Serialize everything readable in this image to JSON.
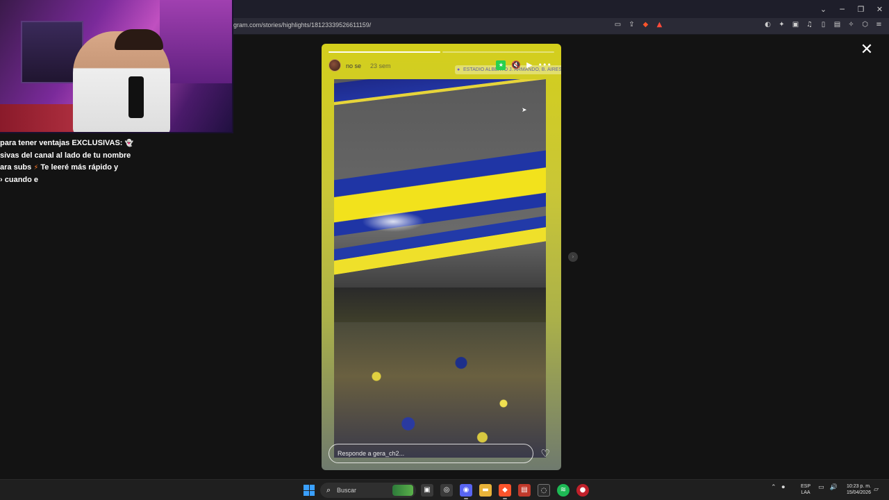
{
  "browser": {
    "url": "gram.com/stories/highlights/18123339526611159/",
    "window_controls": [
      "⌄",
      "─",
      "❐",
      "✕"
    ],
    "left_icons": [
      "cast-icon",
      "share-icon",
      "brave-shield-icon",
      "warning-icon"
    ],
    "right_icons": [
      "puzzle-icon",
      "extension-icon",
      "music-icon",
      "sidebar-icon",
      "wallet-icon",
      "ai-icon",
      "vpn-icon",
      "menu-icon"
    ]
  },
  "story": {
    "username": "no se",
    "time_ago": "23 sem",
    "location": "ESTADIO ALBERTO J. ARMANDO, B. AIRES...",
    "reply_placeholder": "Responde a gera_ch2...",
    "progress_segments": 2,
    "progress_done": 1,
    "header_icons": [
      "star-icon",
      "volume-icon",
      "play-icon",
      "more-icon"
    ],
    "accent_color": "#d4cf1c"
  },
  "chat": {
    "lines": [
      {
        "text": "para tener ventajas EXCLUSIVAS:",
        "emoji": "👻"
      },
      {
        "text": "sivas del canal al lado de tu nombre",
        "emoji": ""
      },
      {
        "text": "ara subs",
        "emoji": "⚡",
        "rest": "Te leeré más rápido y"
      },
      {
        "text": "cuando e",
        "emoji": ""
      }
    ]
  },
  "taskbar": {
    "search_label": "Buscar",
    "language": "ESP",
    "language_sub": "LAA",
    "time": "10:23 p. m.",
    "date": "15/04/2026",
    "apps": [
      "task-view-icon",
      "chrome-icon",
      "discord-icon",
      "file-explorer-icon",
      "brave-icon",
      "news-icon",
      "obs-icon",
      "spotify-icon",
      "app-red-icon"
    ]
  }
}
